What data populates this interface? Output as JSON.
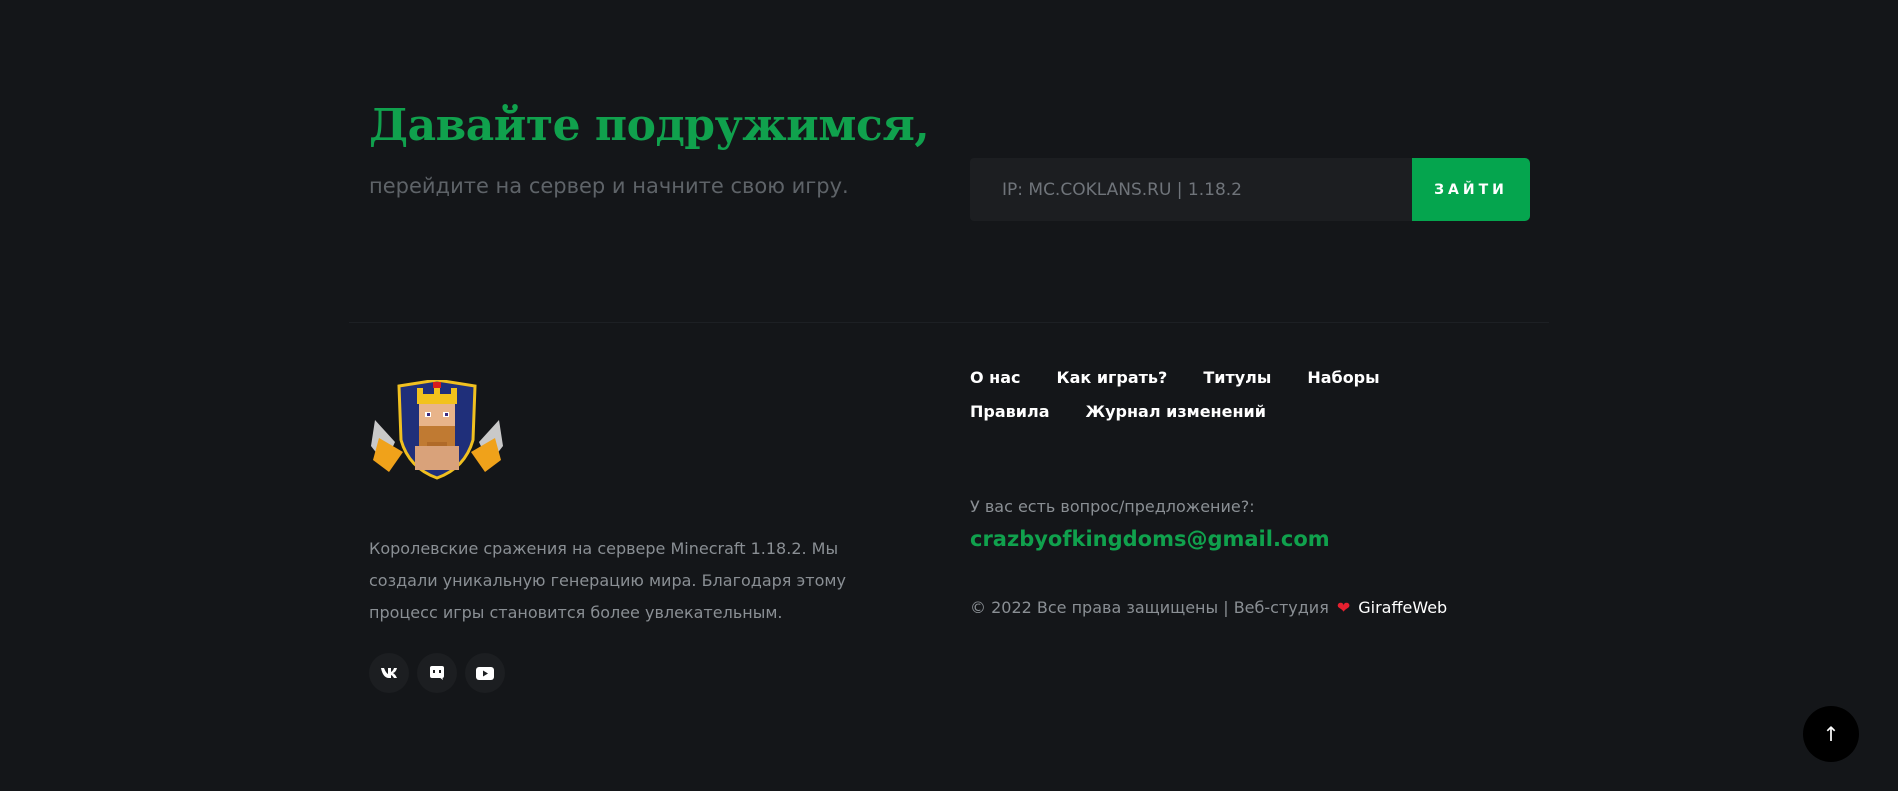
{
  "cta": {
    "headline": "Давайте подружимся,",
    "subline": "перейдите на сервер и начните свою игру.",
    "ip_value": "IP: MC.COKLANS.RU | 1.18.2",
    "button_label": "ЗАЙТИ"
  },
  "footer": {
    "description": "Королевские сражения на сервере Minecraft 1.18.2. Мы создали уникальную генерацию мира. Благодаря этому процесс игры становится более увлекательным.",
    "socials": [
      {
        "icon": "vk-icon"
      },
      {
        "icon": "discord-icon"
      },
      {
        "icon": "youtube-icon"
      }
    ],
    "nav": [
      "О нас",
      "Как играть?",
      "Титулы",
      "Наборы",
      "Правила",
      "Журнал изменений"
    ],
    "question": "У вас есть вопрос/предложение?:",
    "email": "crazbyofkingdoms@gmail.com",
    "copyright": "© 2022 Все права защищены | Веб-студия",
    "studio": "GiraffeWeb"
  },
  "colors": {
    "background": "#141619",
    "accent": "#10a14d",
    "button": "#05a54e"
  }
}
